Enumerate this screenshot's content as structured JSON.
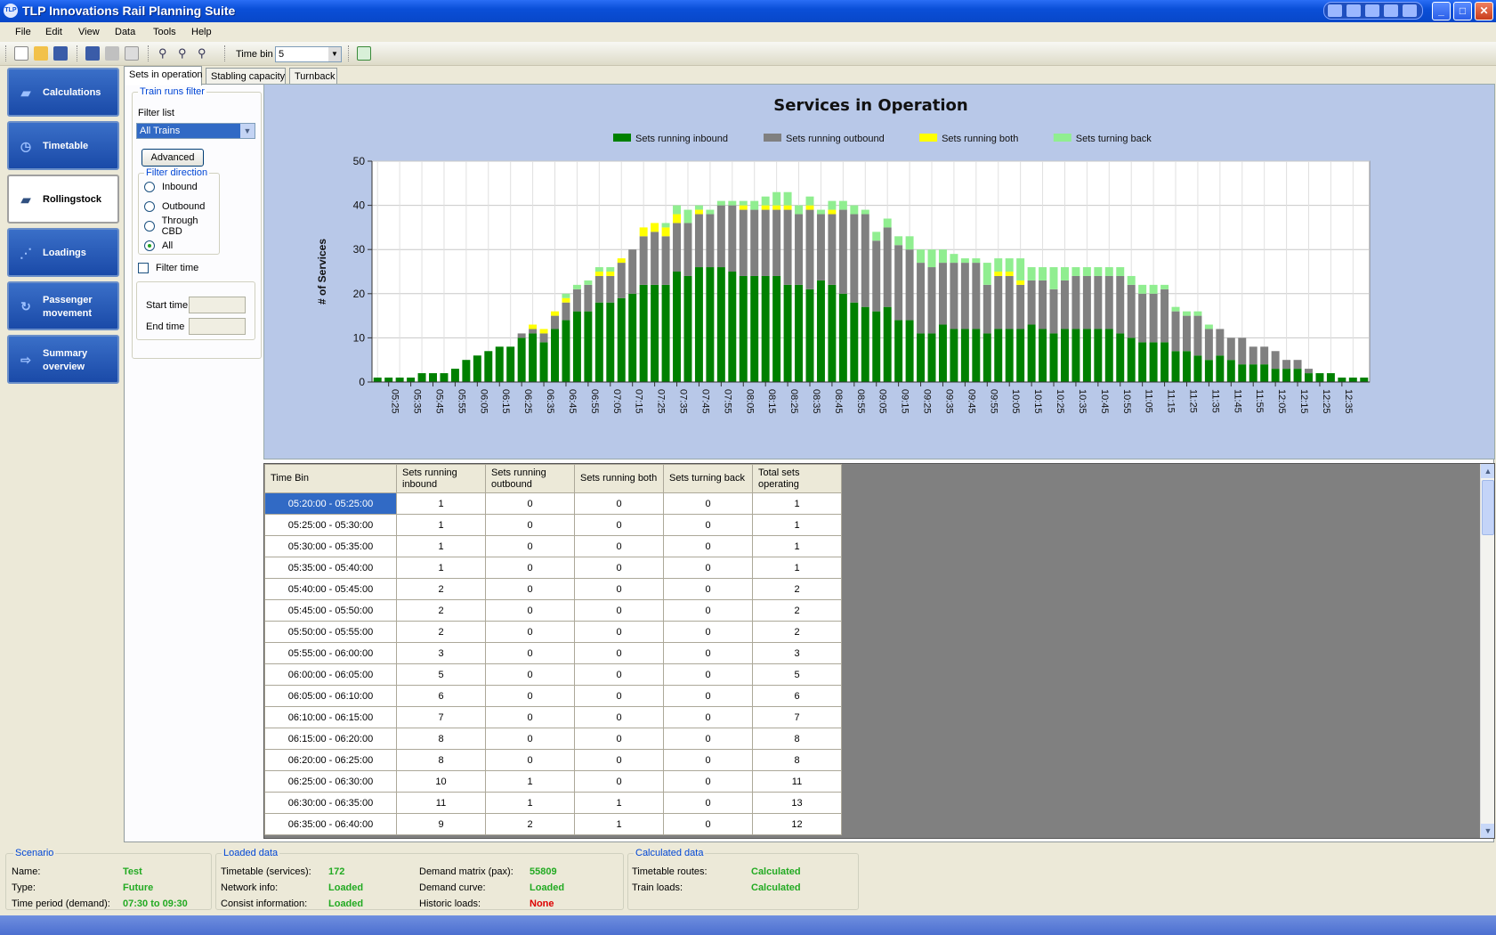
{
  "window": {
    "title": "TLP Innovations Rail Planning Suite",
    "icon_text": "TLP"
  },
  "menu": [
    "File",
    "Edit",
    "View",
    "Data",
    "Tools",
    "Help"
  ],
  "toolbar": {
    "timebin_label": "Time bin",
    "timebin_value": "5"
  },
  "nav": [
    {
      "label": "Calculations",
      "icon": "train-icon"
    },
    {
      "label": "Timetable",
      "icon": "stopwatch-icon"
    },
    {
      "label": "Rollingstock",
      "icon": "train-icon",
      "active": true
    },
    {
      "label": "Loadings",
      "icon": "line-chart-icon"
    },
    {
      "label": "Passenger movement",
      "icon": "cycle-arrows-icon"
    },
    {
      "label": "Summary overview",
      "icon": "arrow-right-icon"
    }
  ],
  "tabs": [
    "Sets in operation",
    "Stabling capacity",
    "Turnback"
  ],
  "filter": {
    "group_title": "Train runs filter",
    "list_label": "Filter list",
    "list_value": "All Trains",
    "advanced_label": "Advanced",
    "direction_title": "Filter direction",
    "directions": [
      "Inbound",
      "Outbound",
      "Through CBD",
      "All"
    ],
    "selected_direction": "All",
    "filter_time_label": "Filter time",
    "start_time_label": "Start time",
    "end_time_label": "End time"
  },
  "chart_data": {
    "type": "bar",
    "stacked": true,
    "title": "Services in Operation",
    "ylabel": "# of Services",
    "xlabel": "",
    "ylim": [
      0,
      50
    ],
    "yticks": [
      0,
      10,
      20,
      30,
      40,
      50
    ],
    "legend_position": "top-center",
    "grid": true,
    "tick_labels": [
      "05:25",
      "05:35",
      "05:45",
      "05:55",
      "06:05",
      "06:15",
      "06:25",
      "06:35",
      "06:45",
      "06:55",
      "07:05",
      "07:15",
      "07:25",
      "07:35",
      "07:45",
      "07:55",
      "08:05",
      "08:15",
      "08:25",
      "08:35",
      "08:45",
      "08:55",
      "09:05",
      "09:15",
      "09:25",
      "09:35",
      "09:45",
      "09:55",
      "10:05",
      "10:15",
      "10:25",
      "10:35",
      "10:45",
      "10:55",
      "11:05",
      "11:15",
      "11:25",
      "11:35",
      "11:45",
      "11:55",
      "12:05",
      "12:15",
      "12:25",
      "12:35"
    ],
    "series": [
      {
        "name": "Sets running inbound",
        "color": "#008000",
        "values": [
          1,
          1,
          1,
          1,
          2,
          2,
          2,
          3,
          5,
          6,
          7,
          8,
          8,
          10,
          11,
          9,
          12,
          14,
          16,
          16,
          18,
          18,
          19,
          20,
          22,
          22,
          22,
          25,
          24,
          26,
          26,
          26,
          25,
          24,
          24,
          24,
          24,
          22,
          22,
          21,
          23,
          22,
          20,
          18,
          17,
          16,
          17,
          14,
          14,
          11,
          11,
          13,
          12,
          12,
          12,
          11,
          12,
          12,
          12,
          13,
          12,
          11,
          12,
          12,
          12,
          12,
          12,
          11,
          10,
          9,
          9,
          9,
          7,
          7,
          6,
          5,
          6,
          5,
          4,
          4,
          4,
          3,
          3,
          3,
          2,
          2,
          2,
          1,
          1,
          1
        ]
      },
      {
        "name": "Sets running outbound",
        "color": "#808080",
        "values": [
          0,
          0,
          0,
          0,
          0,
          0,
          0,
          0,
          0,
          0,
          0,
          0,
          0,
          1,
          1,
          2,
          3,
          4,
          5,
          6,
          6,
          6,
          8,
          10,
          11,
          12,
          11,
          11,
          12,
          12,
          12,
          14,
          15,
          15,
          15,
          15,
          15,
          17,
          16,
          18,
          15,
          16,
          19,
          20,
          21,
          16,
          18,
          17,
          16,
          16,
          15,
          14,
          15,
          15,
          15,
          11,
          12,
          12,
          10,
          10,
          11,
          10,
          11,
          12,
          12,
          12,
          12,
          13,
          12,
          11,
          11,
          12,
          9,
          8,
          9,
          7,
          6,
          5,
          6,
          4,
          4,
          4,
          2,
          2,
          1,
          0,
          0,
          0,
          0,
          0
        ]
      },
      {
        "name": "Sets running both",
        "color": "#ffff00",
        "values": [
          0,
          0,
          0,
          0,
          0,
          0,
          0,
          0,
          0,
          0,
          0,
          0,
          0,
          0,
          1,
          1,
          1,
          1,
          0,
          0,
          1,
          1,
          1,
          0,
          2,
          2,
          2,
          2,
          0,
          1,
          0,
          0,
          0,
          1,
          0,
          1,
          1,
          1,
          0,
          1,
          0,
          1,
          0,
          0,
          0,
          0,
          0,
          0,
          0,
          0,
          0,
          0,
          0,
          0,
          0,
          0,
          1,
          1,
          1,
          0,
          0,
          0,
          0,
          0,
          0,
          0,
          0,
          0,
          0,
          0,
          0,
          0,
          0,
          0,
          0,
          0,
          0,
          0,
          0,
          0,
          0,
          0,
          0,
          0,
          0,
          0,
          0,
          0,
          0,
          0
        ]
      },
      {
        "name": "Sets turning back",
        "color": "#90ee90",
        "values": [
          0,
          0,
          0,
          0,
          0,
          0,
          0,
          0,
          0,
          0,
          0,
          0,
          0,
          0,
          0,
          0,
          0,
          1,
          1,
          1,
          1,
          1,
          0,
          0,
          0,
          0,
          1,
          2,
          3,
          1,
          1,
          1,
          1,
          1,
          2,
          2,
          3,
          3,
          2,
          2,
          1,
          2,
          2,
          2,
          1,
          2,
          2,
          2,
          3,
          3,
          4,
          3,
          2,
          1,
          1,
          5,
          3,
          3,
          5,
          3,
          3,
          5,
          3,
          2,
          2,
          2,
          2,
          2,
          2,
          2,
          2,
          1,
          1,
          1,
          1,
          1,
          0,
          0,
          0,
          0,
          0,
          0,
          0,
          0,
          0,
          0,
          0,
          0,
          0,
          0
        ]
      }
    ]
  },
  "table": {
    "columns": [
      "Time Bin",
      "Sets running inbound",
      "Sets running outbound",
      "Sets running both",
      "Sets turning back",
      "Total sets operating"
    ],
    "rows": [
      [
        "05:20:00 - 05:25:00",
        "1",
        "0",
        "0",
        "0",
        "1"
      ],
      [
        "05:25:00 - 05:30:00",
        "1",
        "0",
        "0",
        "0",
        "1"
      ],
      [
        "05:30:00 - 05:35:00",
        "1",
        "0",
        "0",
        "0",
        "1"
      ],
      [
        "05:35:00 - 05:40:00",
        "1",
        "0",
        "0",
        "0",
        "1"
      ],
      [
        "05:40:00 - 05:45:00",
        "2",
        "0",
        "0",
        "0",
        "2"
      ],
      [
        "05:45:00 - 05:50:00",
        "2",
        "0",
        "0",
        "0",
        "2"
      ],
      [
        "05:50:00 - 05:55:00",
        "2",
        "0",
        "0",
        "0",
        "2"
      ],
      [
        "05:55:00 - 06:00:00",
        "3",
        "0",
        "0",
        "0",
        "3"
      ],
      [
        "06:00:00 - 06:05:00",
        "5",
        "0",
        "0",
        "0",
        "5"
      ],
      [
        "06:05:00 - 06:10:00",
        "6",
        "0",
        "0",
        "0",
        "6"
      ],
      [
        "06:10:00 - 06:15:00",
        "7",
        "0",
        "0",
        "0",
        "7"
      ],
      [
        "06:15:00 - 06:20:00",
        "8",
        "0",
        "0",
        "0",
        "8"
      ],
      [
        "06:20:00 - 06:25:00",
        "8",
        "0",
        "0",
        "0",
        "8"
      ],
      [
        "06:25:00 - 06:30:00",
        "10",
        "1",
        "0",
        "0",
        "11"
      ],
      [
        "06:30:00 - 06:35:00",
        "11",
        "1",
        "1",
        "0",
        "13"
      ],
      [
        "06:35:00 - 06:40:00",
        "9",
        "2",
        "1",
        "0",
        "12"
      ]
    ]
  },
  "status": {
    "scenario": {
      "title": "Scenario",
      "items": [
        [
          "Name:",
          "Test"
        ],
        [
          "Type:",
          "Future"
        ],
        [
          "Time period (demand):",
          "07:30 to 09:30"
        ]
      ]
    },
    "loaded": {
      "title": "Loaded data",
      "left": [
        [
          "Timetable (services):",
          "172"
        ],
        [
          "Network info:",
          "Loaded"
        ],
        [
          "Consist information:",
          "Loaded"
        ]
      ],
      "right": [
        [
          "Demand matrix (pax):",
          "55809"
        ],
        [
          "Demand curve:",
          "Loaded"
        ],
        [
          "Historic loads:",
          "None"
        ]
      ]
    },
    "calculated": {
      "title": "Calculated data",
      "items": [
        [
          "Timetable routes:",
          "Calculated"
        ],
        [
          "Train loads:",
          "Calculated"
        ]
      ]
    }
  },
  "colors": {
    "accent": "#316ac5",
    "nav_bg": "#1a4aa8",
    "chart_bg": "#b8c8e8"
  }
}
